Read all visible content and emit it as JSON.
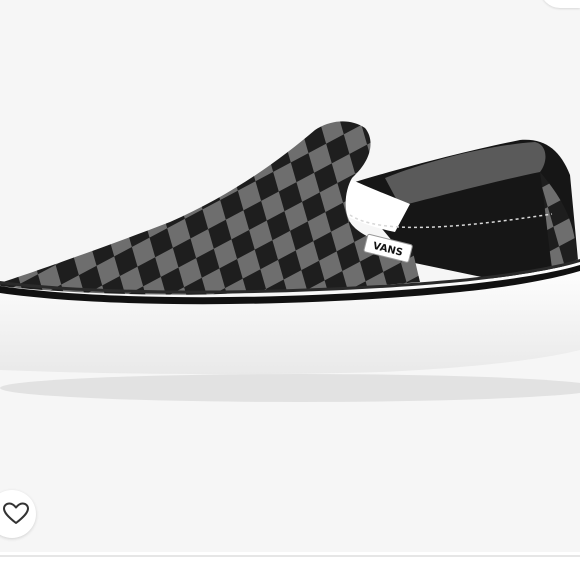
{
  "listing": {
    "brand_label": "VANS",
    "colors": {
      "background": "#f6f6f6",
      "check_dark": "#1e1e1e",
      "check_light": "#6e6e6e",
      "sole": "#ffffff",
      "stripe": "#111111"
    }
  },
  "controls": {
    "like_icon": "heart-outline-icon",
    "corner_control": "menu-icon"
  }
}
